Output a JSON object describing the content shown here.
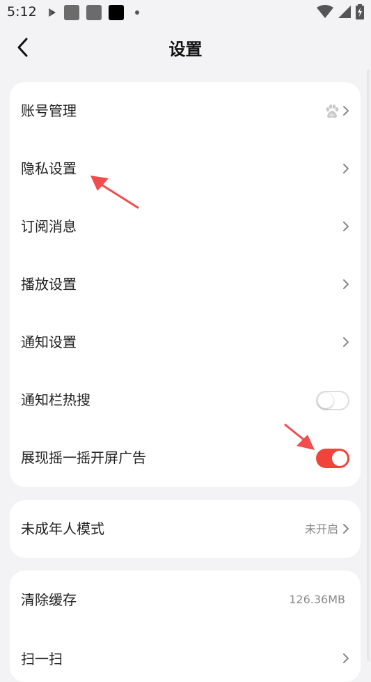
{
  "status": {
    "time": "5:12",
    "icons": [
      "play-icon",
      "app-icon",
      "app-icon",
      "app-icon",
      "dot-icon",
      "wifi-icon",
      "signal-icon",
      "battery-icon"
    ]
  },
  "nav": {
    "title": "设置"
  },
  "card1": {
    "items": [
      {
        "label": "账号管理"
      },
      {
        "label": "隐私设置"
      },
      {
        "label": "订阅消息"
      },
      {
        "label": "播放设置"
      },
      {
        "label": "通知设置"
      },
      {
        "label": "通知栏热搜",
        "toggle": false
      },
      {
        "label": "展现摇一摇开屏广告",
        "toggle": true
      }
    ]
  },
  "card2": {
    "items": [
      {
        "label": "未成年人模式",
        "value": "未开启"
      }
    ]
  },
  "card3": {
    "items": [
      {
        "label": "清除缓存",
        "value": "126.36MB"
      },
      {
        "label": "扫一扫"
      }
    ]
  },
  "colors": {
    "accent": "#f0433a",
    "background": "#f3f3f5",
    "card": "#ffffff"
  }
}
